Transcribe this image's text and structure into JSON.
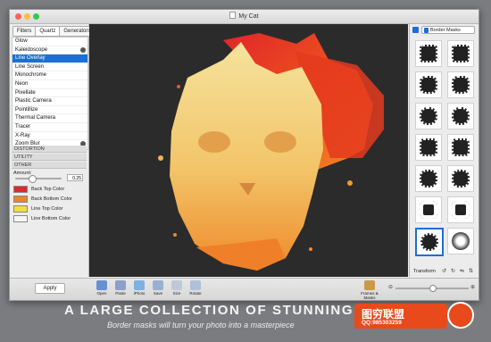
{
  "window": {
    "title": "My Cat"
  },
  "left_panel": {
    "tabs": [
      "Filters",
      "Quartz",
      "Generators"
    ],
    "active_tab": "Quartz",
    "filters": [
      {
        "label": "Glow",
        "info": false
      },
      {
        "label": "Kaleidoscope",
        "info": true
      },
      {
        "label": "Line Overlay",
        "info": false,
        "selected": true
      },
      {
        "label": "Line Screen",
        "info": false
      },
      {
        "label": "Monochrome",
        "info": false
      },
      {
        "label": "Neon",
        "info": false
      },
      {
        "label": "Pixellate",
        "info": false
      },
      {
        "label": "Plastic Camera",
        "info": false
      },
      {
        "label": "Pointillize",
        "info": false
      },
      {
        "label": "Thermal Camera",
        "info": false
      },
      {
        "label": "Tracer",
        "info": false
      },
      {
        "label": "X-Ray",
        "info": false
      },
      {
        "label": "Zoom Blur",
        "info": true
      }
    ],
    "sections": [
      "DISTORTION",
      "UTILITY",
      "OTHER"
    ],
    "amount_label": "Amount:",
    "amount_value": "0.25",
    "amount_fraction": 0.35,
    "colors": [
      {
        "label": "Back Top Color",
        "color": "#d92b2b"
      },
      {
        "label": "Back Bottom Color",
        "color": "#e8862a"
      },
      {
        "label": "Line Top Color",
        "color": "#efe040"
      },
      {
        "label": "Line Bottom Color",
        "color": "#f6f6f6"
      }
    ],
    "apply_label": "Apply"
  },
  "right_panel": {
    "mask_dropdown": "Border Masks",
    "checked": true,
    "transform_label": "Transform",
    "selected_thumb": 12
  },
  "toolbar": {
    "buttons": [
      {
        "label": "Open",
        "icon": "folder-icon",
        "color": "#6a8fd0"
      },
      {
        "label": "Paste",
        "icon": "paste-icon",
        "color": "#8aa0c8"
      },
      {
        "label": "iPhoto",
        "icon": "iphoto-icon",
        "color": "#7fb0e0"
      },
      {
        "label": "Save",
        "icon": "save-icon",
        "color": "#9ab0d0"
      },
      {
        "label": "Size",
        "icon": "size-icon",
        "color": "#c0c8d8"
      },
      {
        "label": "Rotate",
        "icon": "rotate-icon",
        "color": "#b0c0d8"
      }
    ],
    "frames_label": "Frames & Masks"
  },
  "promo": {
    "headline": "A LARGE COLLECTION OF STUNNING",
    "subline": "Border masks will turn your photo into a masterpiece"
  },
  "watermark": {
    "title": "图穷联盟",
    "qq": "QQ:985303259"
  }
}
